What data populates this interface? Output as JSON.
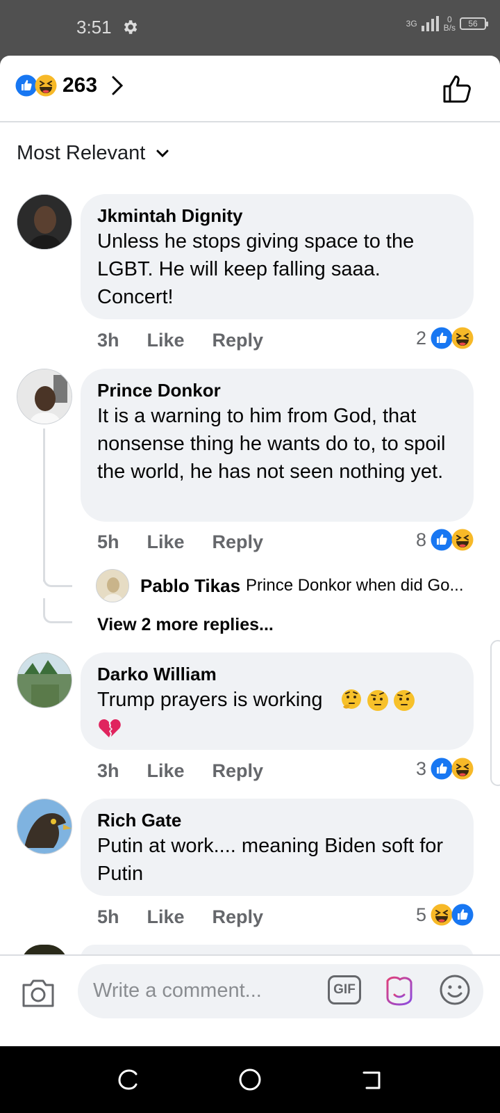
{
  "status_bar": {
    "time": "3:51",
    "network_label": "3G",
    "speed_value": "0",
    "speed_unit": "B/s",
    "battery": "56"
  },
  "header": {
    "reaction_count": "263",
    "reaction_icons": [
      "like-icon",
      "haha-icon"
    ]
  },
  "sort": {
    "label": "Most Relevant"
  },
  "comments": [
    {
      "author": "Jkmintah Dignity",
      "text": "Unless he stops giving space to the LGBT. He will keep falling saaa. Concert!",
      "time": "3h",
      "like_label": "Like",
      "reply_label": "Reply",
      "reaction_count": "2",
      "reactions": [
        "like-icon",
        "haha-icon"
      ]
    },
    {
      "author": "Prince Donkor",
      "text": "It is a warning to him from God, that nonsense thing he wants do to, to spoil the world, he has not seen nothing yet.",
      "time": "5h",
      "like_label": "Like",
      "reply_label": "Reply",
      "reaction_count": "8",
      "reactions": [
        "like-icon",
        "haha-icon"
      ],
      "reply_preview": {
        "author": "Pablo Tikas",
        "text": "Prince Donkor when did Go..."
      },
      "view_more": "View 2 more replies..."
    },
    {
      "author": "Darko William",
      "text": "Trump  prayers is working",
      "emojis": [
        "thinking-face-icon",
        "raised-eyebrow-face-icon",
        "raised-eyebrow-face-icon",
        "broken-heart-icon"
      ],
      "time": "3h",
      "like_label": "Like",
      "reply_label": "Reply",
      "reaction_count": "3",
      "reactions": [
        "like-icon",
        "haha-icon"
      ]
    },
    {
      "author": "Rich Gate",
      "text": "Putin at work.... meaning Biden soft for Putin",
      "time": "5h",
      "like_label": "Like",
      "reply_label": "Reply",
      "reaction_count": "5",
      "reactions": [
        "haha-icon",
        "like-icon"
      ]
    }
  ],
  "composer": {
    "placeholder": "Write a comment...",
    "gif_label": "GIF"
  },
  "colors": {
    "like_blue": "#1877f2",
    "haha_yellow": "#f7b928",
    "bubble_bg": "#f0f2f5",
    "meta_gray": "#65676b"
  }
}
